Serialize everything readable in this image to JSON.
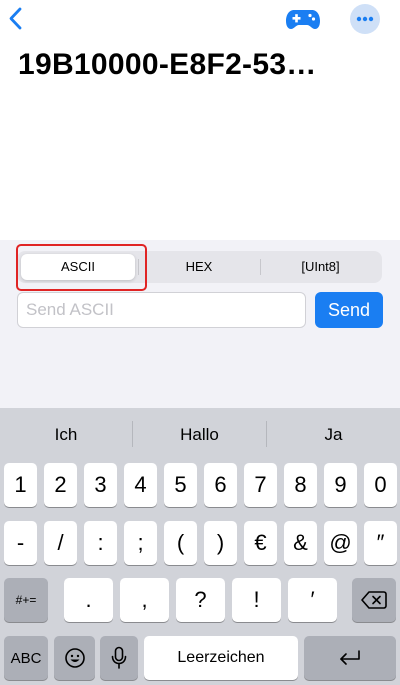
{
  "header": {
    "title": "19B10000-E8F2-53…",
    "back_icon": "chevron-left-icon",
    "gamepad_icon": "gamepad-icon",
    "more_icon": "ellipsis-icon",
    "accent_color": "#1a7ef2"
  },
  "format_selector": {
    "options": [
      "ASCII",
      "HEX",
      "[UInt8]"
    ],
    "selected": "ASCII"
  },
  "send_bar": {
    "placeholder": "Send ASCII",
    "value": "",
    "button_label": "Send"
  },
  "keyboard": {
    "suggestions": [
      "Ich",
      "Hallo",
      "Ja"
    ],
    "row1": [
      "1",
      "2",
      "3",
      "4",
      "5",
      "6",
      "7",
      "8",
      "9",
      "0"
    ],
    "row2": [
      "-",
      "/",
      ":",
      ";",
      "(",
      ")",
      "€",
      "&",
      "@",
      "″"
    ],
    "row3_toggle": "#+=",
    "row3": [
      ".",
      ",",
      "?",
      "!",
      "′"
    ],
    "row3_delete_icon": "backspace-icon",
    "row4_abc": "ABC",
    "row4_emoji_icon": "emoji-icon",
    "row4_mic_icon": "microphone-icon",
    "space_label": "Leerzeichen",
    "return_icon": "return-icon"
  }
}
